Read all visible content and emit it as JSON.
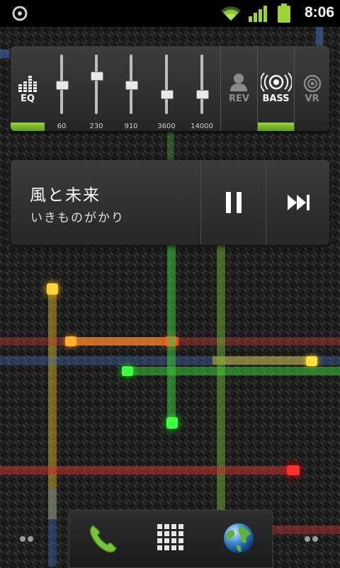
{
  "status_bar": {
    "time": "8:06",
    "notification_icon": "disc-icon",
    "wifi_icon": "wifi-icon",
    "signal_icon": "signal-icon",
    "battery_icon": "battery-icon",
    "accent_color": "#9ad33a"
  },
  "eq_widget": {
    "eq_label": "EQ",
    "eq_active": true,
    "sliders": [
      {
        "freq": "60",
        "level": 0.5
      },
      {
        "freq": "230",
        "level": 0.66
      },
      {
        "freq": "910",
        "level": 0.5
      },
      {
        "freq": "3600",
        "level": 0.34
      },
      {
        "freq": "14000",
        "level": 0.34
      }
    ],
    "rev_label": "REV",
    "rev_active": false,
    "bass_label": "BASS",
    "bass_active": true,
    "vr_label": "VR",
    "vr_active": false
  },
  "music_widget": {
    "title": "風と未来",
    "artist": "いきものがかり",
    "pause_icon": "pause-icon",
    "next_icon": "skip-next-icon"
  },
  "dock": {
    "phone_icon": "phone-icon",
    "apps_icon": "app-grid-icon",
    "browser_icon": "globe-icon"
  }
}
